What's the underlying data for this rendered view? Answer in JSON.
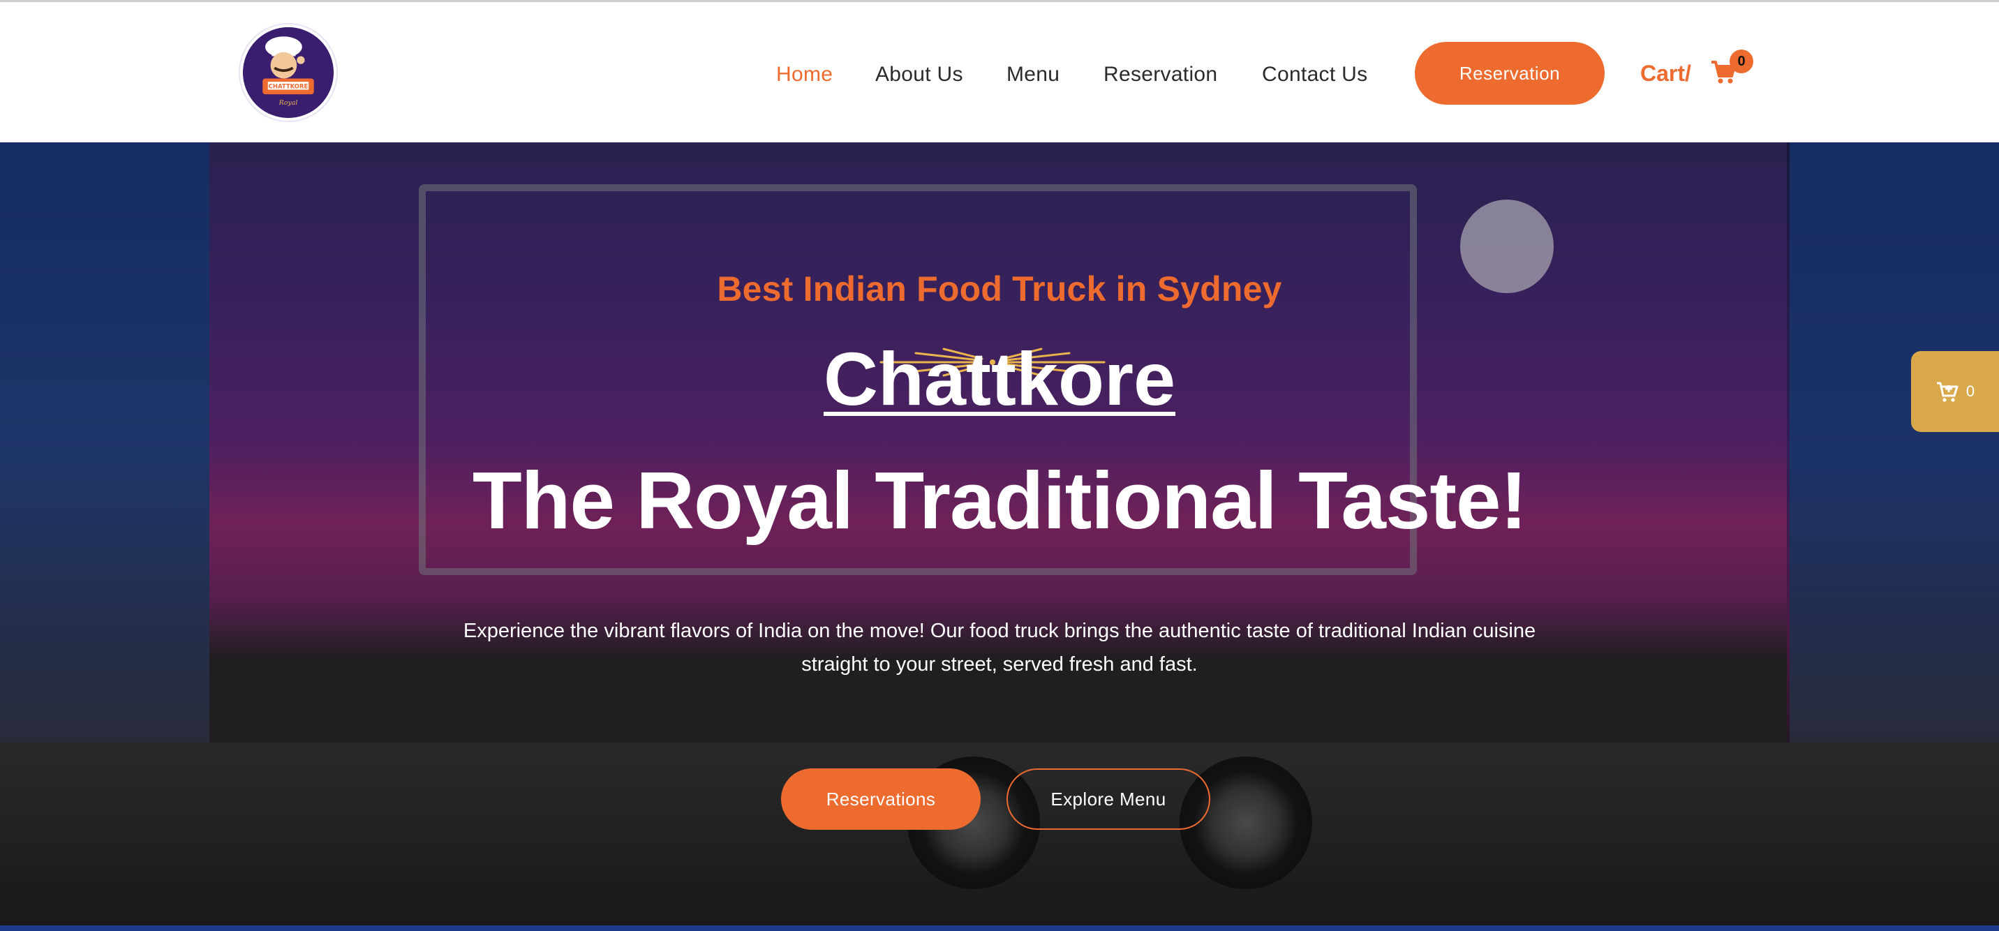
{
  "colors": {
    "accent": "#ee6b2f",
    "side_cart": "#d8a84a",
    "text_dark": "#2b2b2b"
  },
  "header": {
    "logo_text": "CHATTKORE",
    "nav": [
      {
        "label": "Home",
        "active": true
      },
      {
        "label": "About Us",
        "active": false
      },
      {
        "label": "Menu",
        "active": false
      },
      {
        "label": "Reservation",
        "active": false
      },
      {
        "label": "Contact Us",
        "active": false
      }
    ],
    "reservation_button": "Reservation",
    "cart_label": "Cart/",
    "cart_icon": "cart-icon",
    "cart_count": "0"
  },
  "hero": {
    "eyebrow": "Best Indian Food Truck in Sydney",
    "brand": "Chattkore",
    "tagline": "The Royal Traditional Taste!",
    "description": "Experience the vibrant flavors of India on the move! Our food truck brings the authentic taste of traditional Indian cuisine straight to your street, served fresh and fast.",
    "primary_button": "Reservations",
    "secondary_button": "Explore Menu"
  },
  "side_cart": {
    "icon": "cart-plus-icon",
    "count": "0"
  }
}
